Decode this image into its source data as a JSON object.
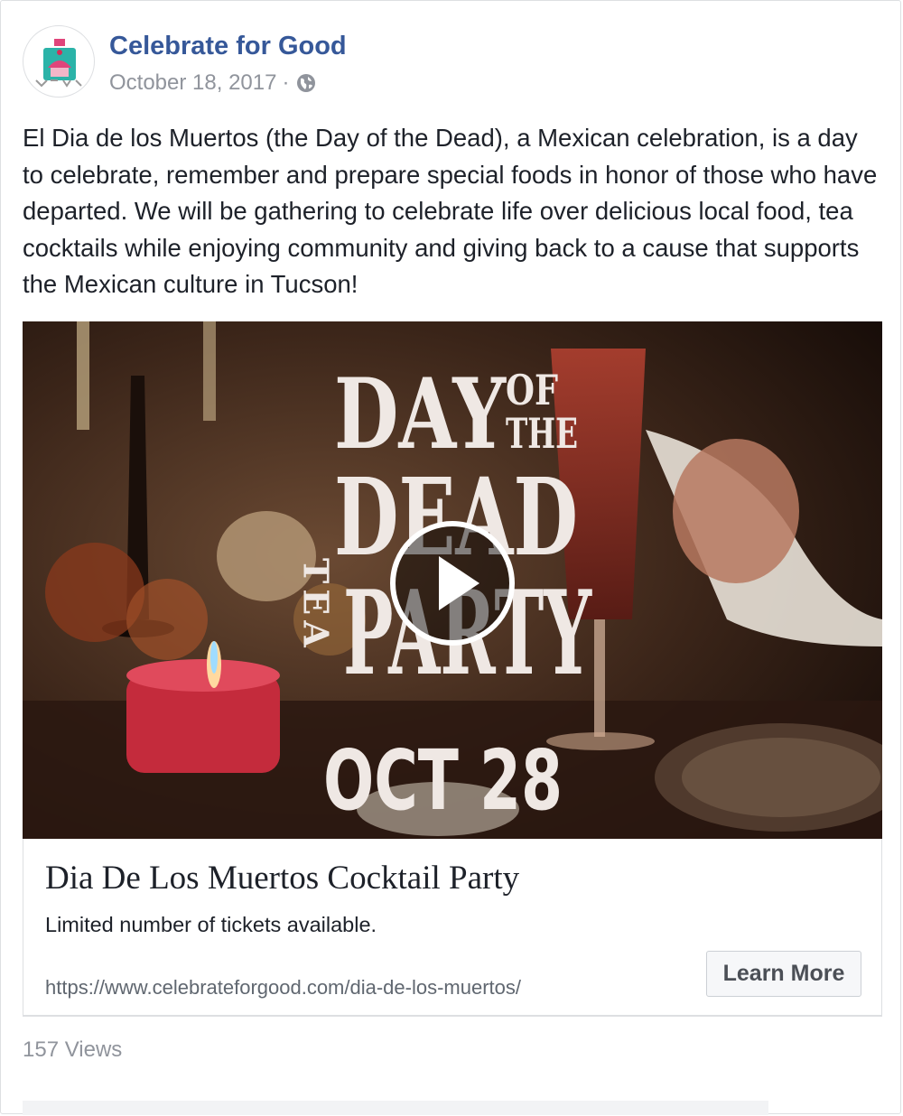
{
  "post": {
    "page_name": "Celebrate for Good",
    "date": "October 18, 2017",
    "separator": "·",
    "audience_icon": "globe-icon",
    "text": "El Dia de los Muertos (the Day of the Dead), a Mexican celebration, is a day to celebrate, remember and prepare special foods in honor of those who have departed. We will be gathering to celebrate life over delicious local food, tea cocktails while enjoying community and giving back to a cause that supports the Mexican culture in Tucson!"
  },
  "video": {
    "poster_title_day": "DAY",
    "poster_title_of": "OF",
    "poster_title_the": "THE",
    "poster_title_dead": "DEAD",
    "poster_title_tea": "TEA",
    "poster_title_party": "PARTY",
    "poster_date": "OCT 28",
    "play_icon": "play-icon"
  },
  "link": {
    "title": "Dia De Los Muertos Cocktail Party",
    "description": "Limited number of tickets available.",
    "url": "https://www.celebrateforgood.com/dia-de-los-muertos/",
    "cta_label": "Learn More"
  },
  "stats": {
    "views": "157 Views"
  },
  "colors": {
    "page_name": "#365899",
    "meta_text": "#90949c",
    "border": "#dddfe2"
  }
}
